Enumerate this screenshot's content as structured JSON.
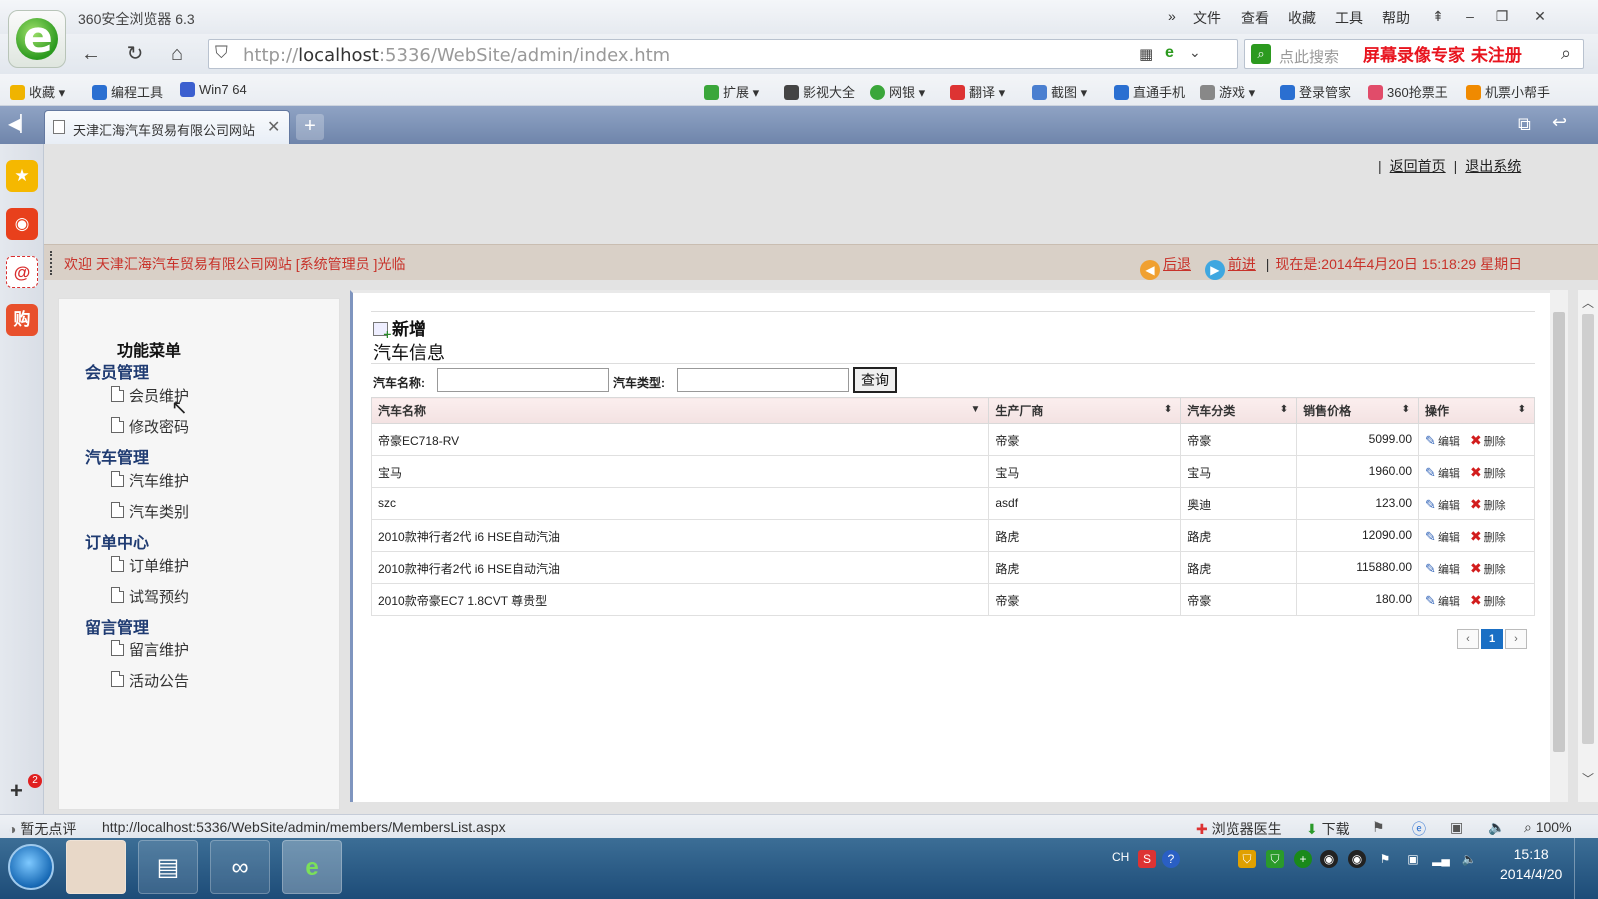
{
  "browser": {
    "window_title": "360安全浏览器 6.3",
    "menu": [
      "文件",
      "查看",
      "收藏",
      "工具",
      "帮助"
    ],
    "url_host": "localhost",
    "url_rest": ":5336/WebSite/admin/index.htm",
    "url_prefix": "http://",
    "search_placeholder": "点此搜索",
    "recorder_watermark": "屏幕录像专家  未注册",
    "bookmarks_left": [
      "收藏",
      "编程工具",
      "Win7 64"
    ],
    "bookmarks_right": [
      "扩展",
      "影视大全",
      "网银",
      "翻译",
      "截图",
      "直通手机",
      "游戏",
      "登录管家",
      "360抢票王",
      "机票小帮手"
    ],
    "tab_title": "天津汇海汽车贸易有限公司网站",
    "status_url": "http://localhost:5336/WebSite/admin/members/MembersList.aspx",
    "status_left": "暂无点评",
    "status_right": [
      "浏览器医生",
      "下载"
    ],
    "zoom": "100%",
    "sidebar_badge": "2"
  },
  "page": {
    "top_links": [
      "返回首页",
      "退出系统"
    ],
    "welcome": "欢迎 天津汇海汽车贸易有限公司网站 [系统管理员 ]光临",
    "back_label": "后退",
    "forward_label": "前进",
    "now_text": "现在是:2014年4月20日  15:18:29 星期日"
  },
  "menu": {
    "title": "功能菜单",
    "groups": [
      {
        "label": "会员管理",
        "items": [
          "会员维护",
          "修改密码"
        ]
      },
      {
        "label": "汽车管理",
        "items": [
          "汽车维护",
          "汽车类别"
        ]
      },
      {
        "label": "订单中心",
        "items": [
          "订单维护",
          "试驾预约"
        ]
      },
      {
        "label": "留言管理",
        "items": [
          "留言维护",
          "活动公告"
        ]
      }
    ]
  },
  "content": {
    "add_label": "新增",
    "section_title": "汽车信息",
    "filter_name_label": "汽车名称:",
    "filter_type_label": "汽车类型:",
    "query_label": "查询",
    "columns": [
      "汽车名称",
      "生产厂商",
      "汽车分类",
      "销售价格",
      "操作"
    ],
    "edit_label": "编辑",
    "delete_label": "删除",
    "rows": [
      {
        "name": "帝豪EC718-RV",
        "maker": "帝豪",
        "category": "帝豪",
        "price": "5099.00"
      },
      {
        "name": "宝马",
        "maker": "宝马",
        "category": "宝马",
        "price": "1960.00"
      },
      {
        "name": "szc",
        "maker": "asdf",
        "category": "奥迪",
        "price": "123.00"
      },
      {
        "name": "2010款神行者2代 i6 HSE自动汽油",
        "maker": "路虎",
        "category": "路虎",
        "price": "12090.00"
      },
      {
        "name": "2010款神行者2代 i6 HSE自动汽油",
        "maker": "路虎",
        "category": "路虎",
        "price": "115880.00"
      },
      {
        "name": "2010款帝豪EC7 1.8CVT 尊贵型",
        "maker": "帝豪",
        "category": "帝豪",
        "price": "180.00"
      }
    ],
    "pager": {
      "prev": "‹",
      "current": "1",
      "next": "›"
    }
  },
  "taskbar": {
    "time": "15:18",
    "date": "2014/4/20",
    "lang": "CH"
  }
}
